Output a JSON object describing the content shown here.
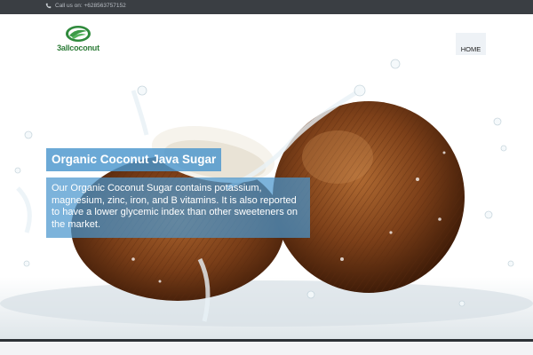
{
  "topbar": {
    "call_text": "Call us on: +628563757152",
    "icon": "phone-icon"
  },
  "header": {
    "logo_text": "3allcoconut",
    "logo_icon": "coconut-leaf-logo-icon",
    "nav": [
      {
        "label": "HOME",
        "active": true
      }
    ]
  },
  "hero": {
    "title": "Organic Coconut Java Sugar",
    "description": "Our Organic Coconut Sugar contains potassium, magnesium, zinc, iron, and B vitamins. It is also reported to have a lower glycemic index than other sweeteners on the market."
  },
  "colors": {
    "topbar_bg": "#3a3e43",
    "accent": "#4aa3df",
    "caption_bg": "#4a96cd",
    "logo_green": "#2f7d3a"
  }
}
